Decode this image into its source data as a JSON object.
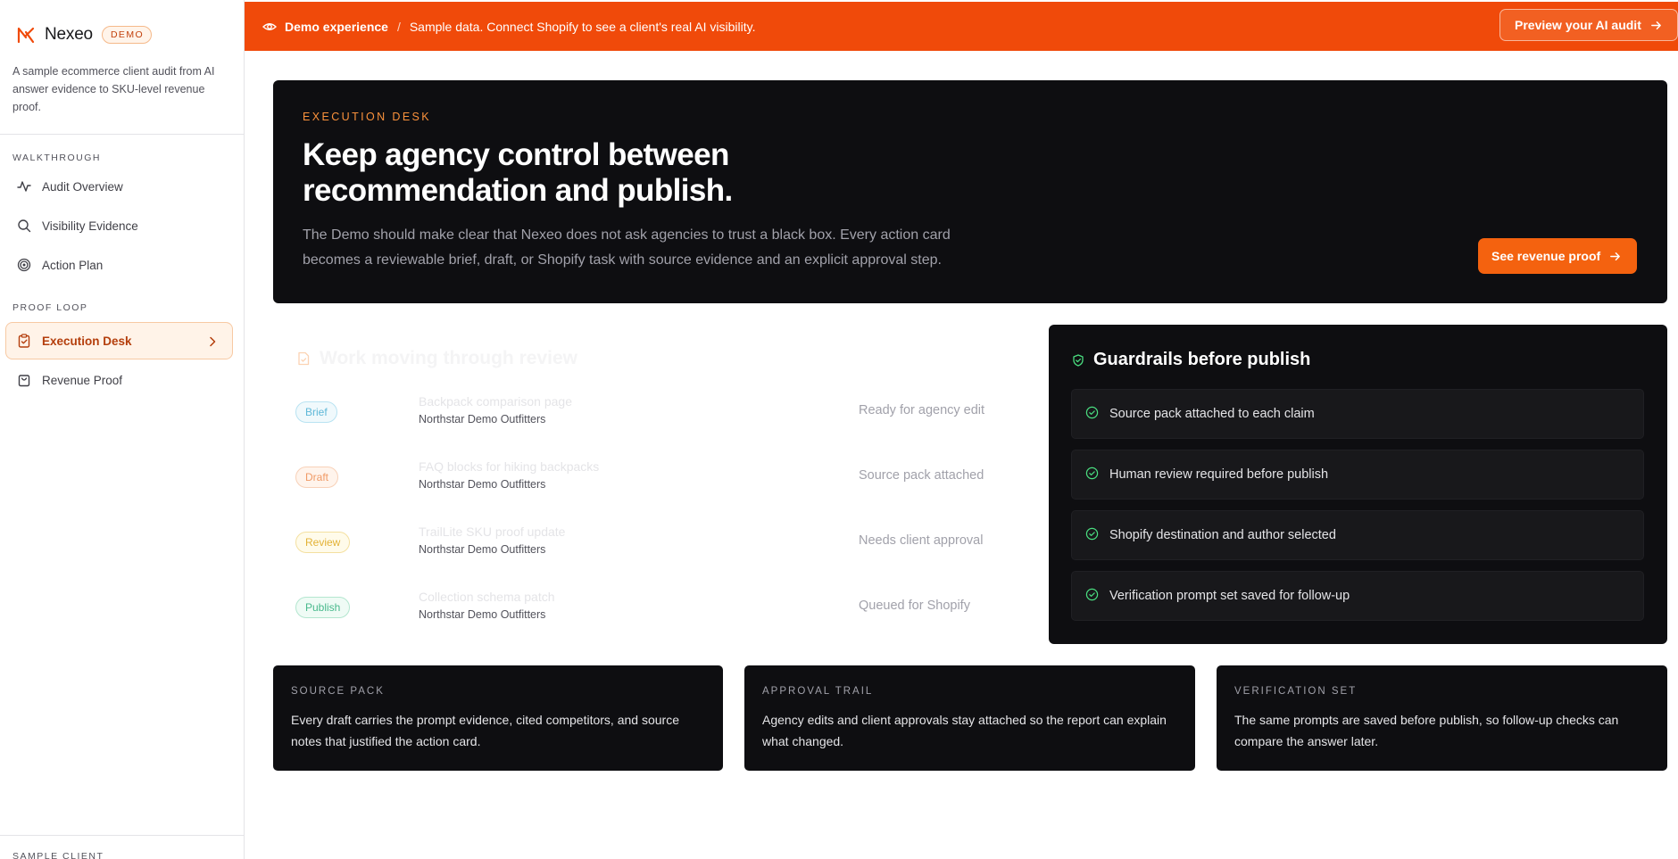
{
  "brand": {
    "name": "Nexeo",
    "badge": "DEMO",
    "description": "A sample ecommerce client audit from AI answer evidence to SKU-level revenue proof."
  },
  "sidebar": {
    "walkthrough_label": "WALKTHROUGH",
    "walkthrough_items": [
      {
        "label": "Audit Overview",
        "icon": "activity-icon"
      },
      {
        "label": "Visibility Evidence",
        "icon": "search-icon"
      },
      {
        "label": "Action Plan",
        "icon": "target-icon"
      }
    ],
    "proof_label": "PROOF LOOP",
    "proof_items": [
      {
        "label": "Execution Desk",
        "icon": "clipboard-check-icon",
        "active": true
      },
      {
        "label": "Revenue Proof",
        "icon": "shopping-bag-icon",
        "active": false
      }
    ],
    "sample_client_label": "SAMPLE CLIENT"
  },
  "banner": {
    "title": "Demo experience",
    "separator": "/",
    "text": "Sample data. Connect Shopify to see a client's real AI visibility.",
    "button_label": "Preview your AI audit"
  },
  "hero": {
    "eyebrow": "EXECUTION DESK",
    "title": "Keep agency control between recommendation and publish.",
    "description": "The Demo should make clear that Nexeo does not ask agencies to trust a black box. Every action card becomes a reviewable brief, draft, or Shopify task with source evidence and an explicit approval step.",
    "button_label": "See revenue proof"
  },
  "work": {
    "title": "Work moving through review",
    "rows": [
      {
        "tag": "Brief",
        "title": "Backpack comparison page",
        "client": "Northstar Demo Outfitters",
        "status": "Ready for agency edit"
      },
      {
        "tag": "Draft",
        "title": "FAQ blocks for hiking backpacks",
        "client": "Northstar Demo Outfitters",
        "status": "Source pack attached"
      },
      {
        "tag": "Review",
        "title": "TrailLite SKU proof update",
        "client": "Northstar Demo Outfitters",
        "status": "Needs client approval"
      },
      {
        "tag": "Publish",
        "title": "Collection schema patch",
        "client": "Northstar Demo Outfitters",
        "status": "Queued for Shopify"
      }
    ]
  },
  "guardrails": {
    "title": "Guardrails before publish",
    "items": [
      "Source pack attached to each claim",
      "Human review required before publish",
      "Shopify destination and author selected",
      "Verification prompt set saved for follow-up"
    ]
  },
  "cards": [
    {
      "label": "SOURCE PACK",
      "text": "Every draft carries the prompt evidence, cited competitors, and source notes that justified the action card."
    },
    {
      "label": "APPROVAL TRAIL",
      "text": "Agency edits and client approvals stay attached so the report can explain what changed."
    },
    {
      "label": "VERIFICATION SET",
      "text": "The same prompts are saved before publish, so follow-up checks can compare the answer later."
    }
  ],
  "colors": {
    "accent": "#f04a0a",
    "dark_panel": "#0e0e11",
    "success": "#4ade80"
  }
}
